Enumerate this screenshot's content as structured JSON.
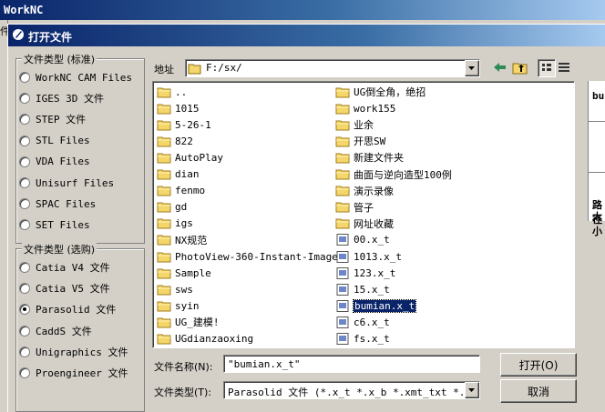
{
  "app": {
    "title": "WorkNC",
    "left_clip": "件"
  },
  "dialog": {
    "title": "打开文件",
    "group_standard": {
      "legend": "文件类型 (标准)",
      "options": [
        "WorkNC CAM Files",
        "IGES 3D 文件",
        "STEP 文件",
        "STL Files",
        "VDA Files",
        "Unisurf Files",
        "SPAC Files",
        "SET Files"
      ]
    },
    "group_optional": {
      "legend": "文件类型 (选购)",
      "options": [
        "Catia V4 文件",
        "Catia V5 文件",
        "Parasolid 文件",
        "CaddS 文件",
        "Unigraphics 文件",
        "Proengineer 文件"
      ],
      "selected": "Parasolid 文件"
    },
    "location": {
      "label": "地址",
      "path": "F:/sx/"
    },
    "files_col1": [
      {
        "name": "..",
        "type": "folder"
      },
      {
        "name": "1015",
        "type": "folder"
      },
      {
        "name": "5-26-1",
        "type": "folder"
      },
      {
        "name": "822",
        "type": "folder"
      },
      {
        "name": "AutoPlay",
        "type": "folder"
      },
      {
        "name": "dian",
        "type": "folder"
      },
      {
        "name": "fenmo",
        "type": "folder"
      },
      {
        "name": "gd",
        "type": "folder"
      },
      {
        "name": "igs",
        "type": "folder"
      },
      {
        "name": "NX规范",
        "type": "folder"
      },
      {
        "name": "PhotoView-360-Instant-Images",
        "type": "folder"
      },
      {
        "name": "Sample",
        "type": "folder"
      },
      {
        "name": "sws",
        "type": "folder"
      },
      {
        "name": "syin",
        "type": "folder"
      },
      {
        "name": "UG_建模!",
        "type": "folder"
      },
      {
        "name": "UGdianzaoxing",
        "type": "folder"
      }
    ],
    "files_col2": [
      {
        "name": "UG倒全角，绝招",
        "type": "folder"
      },
      {
        "name": "work155",
        "type": "folder"
      },
      {
        "name": "业余",
        "type": "folder"
      },
      {
        "name": "开思SW",
        "type": "folder"
      },
      {
        "name": "新建文件夹",
        "type": "folder"
      },
      {
        "name": "曲面与逆向造型100例",
        "type": "folder"
      },
      {
        "name": "演示录像",
        "type": "folder"
      },
      {
        "name": "管子",
        "type": "folder"
      },
      {
        "name": "网址收藏",
        "type": "folder"
      },
      {
        "name": "00.x_t",
        "type": "file"
      },
      {
        "name": "1013.x_t",
        "type": "file"
      },
      {
        "name": "123.x_t",
        "type": "file"
      },
      {
        "name": "15.x_t",
        "type": "file"
      },
      {
        "name": "bumian.x_t",
        "type": "file",
        "selected": true
      },
      {
        "name": "c6.x_t",
        "type": "file"
      },
      {
        "name": "fs.x_t",
        "type": "file"
      }
    ],
    "filename": {
      "label": "文件名称(N):",
      "value": "\"bumian.x_t\""
    },
    "filetype": {
      "label": "文件类型(T):",
      "value": "Parasolid 文件 (*.x_t *.x_b *.xmt_txt *.xm"
    },
    "open_button": "打开(O)",
    "cancel_button": "取消",
    "right_panel": {
      "name": "bu",
      "path_label": "路径",
      "size_label": "大小"
    }
  }
}
